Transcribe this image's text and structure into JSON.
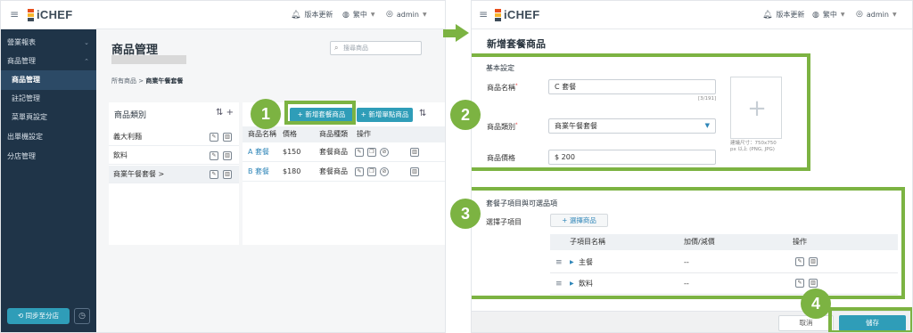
{
  "app": {
    "logo_text": "iCHEF"
  },
  "topbar": {
    "update_label": "版本更新",
    "language_label": "繁中",
    "user_label": "admin"
  },
  "sidebar": {
    "items": [
      {
        "label": "營業報表"
      },
      {
        "label": "商品管理"
      },
      {
        "label": "商品管理"
      },
      {
        "label": "註記管理"
      },
      {
        "label": "菜單頁設定"
      },
      {
        "label": "出單機設定"
      },
      {
        "label": "分店管理"
      }
    ],
    "sync_label": "同步至分店"
  },
  "main": {
    "title": "商品管理",
    "search_placeholder": "搜尋商品",
    "breadcrumb": {
      "root": "所有商品",
      "separator": ">",
      "current": "商業午餐套餐"
    },
    "categories": {
      "header": "商品類別",
      "items": [
        {
          "label": "義大利麵"
        },
        {
          "label": "飲料"
        },
        {
          "label": "商業午餐套餐 >"
        }
      ]
    },
    "buttons": {
      "add_combo": "+ 新增套餐商品",
      "add_single": "+ 新增單點商品"
    },
    "table": {
      "headers": [
        "商品名稱",
        "價格",
        "商品種類",
        "操作"
      ],
      "rows": [
        {
          "name": "A 套餐",
          "price": "$150",
          "type": "套餐商品"
        },
        {
          "name": "B 套餐",
          "price": "$180",
          "type": "套餐商品"
        }
      ]
    }
  },
  "modal": {
    "title": "新增套餐商品",
    "basic_section": "基本設定",
    "name_label": "商品名稱",
    "name_value": "C 套餐",
    "name_counter": "[3/191]",
    "category_label": "商品類別",
    "category_value": "商業午餐套餐",
    "price_label": "商品價格",
    "price_value": "$ 200",
    "image_hint_1": "建議尺寸：750x750",
    "image_hint_2": "px 以上 (PNG, JPG)",
    "sub_section": "套餐子項目與可選品項",
    "select_label": "選擇子項目",
    "select_button": "+ 選擇商品",
    "sub_table": {
      "headers": [
        "子項目名稱",
        "加價/減價",
        "操作"
      ],
      "rows": [
        {
          "name": "主餐",
          "price": "--"
        },
        {
          "name": "飲料",
          "price": "--"
        }
      ]
    },
    "cancel_label": "取消",
    "save_label": "儲存"
  },
  "annotations": {
    "steps": [
      "1",
      "2",
      "3",
      "4"
    ],
    "color": "#7cb342"
  },
  "colors": {
    "accent": "#2f9db8",
    "sidebar": "#1f3448",
    "annotation": "#7cb342"
  }
}
